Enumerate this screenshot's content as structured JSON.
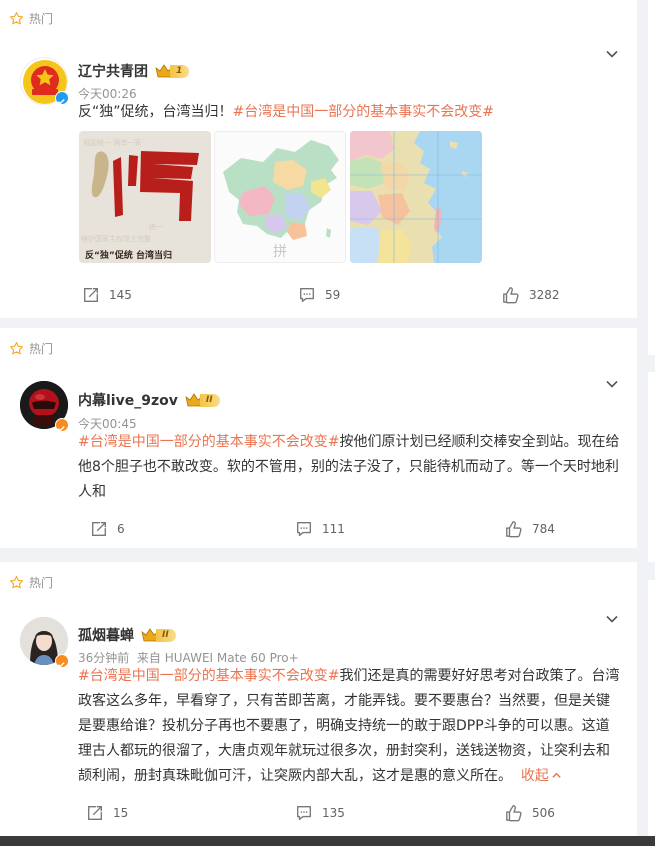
{
  "hot_label": "热门",
  "posts": [
    {
      "author": "辽宁共青团",
      "level": "1",
      "time": "今天00:26",
      "content_plain": "反“独”促统，台湾当归！",
      "content_tag": "#台湾是中国一部分的基本事实不会改变#",
      "image_caption_big": "归",
      "image_caption_small": "反“独”促统 台湾当归",
      "image2_watermark": "拼",
      "reposts": "145",
      "comments": "59",
      "likes": "3282"
    },
    {
      "author": "内幕live_9zov",
      "level": "II",
      "time": "今天00:45",
      "content_tag": "#台湾是中国一部分的基本事实不会改变#",
      "content_line1": "按他们原计划已经顺利交棒安全到站。现在给",
      "content_line2": "他8个胆子也不敢改变。软的不管用，别的法子没了，只能待机而动了。等一个天时地利",
      "content_line3": "人和",
      "reposts": "6",
      "comments": "111",
      "likes": "784"
    },
    {
      "author": "孤烟暮蝉",
      "level": "II",
      "time": "36分钟前",
      "source": "来自 HUAWEI Mate 60 Pro+",
      "content_tag": "#台湾是中国一部分的基本事实不会改变#",
      "content_line1": "我们还是真的需要好好思考对台政策了。台湾",
      "content_line2": "政客这么多年，早看穿了，只有苦即苦离，才能弄钱。要不要惠台？当然要，但是关键",
      "content_line3": "是要惠给谁？投机分子再也不要惠了，明确支持统一的敢于跟DPP斗争的可以惠。这道",
      "content_line4": "理古人都玩的很溜了，大唐贞观年就玩过很多次，册封突利，送钱送物资，让突利去和",
      "content_line5": "颉利闹，册封真珠毗伽可汗，让突厥内部大乱，这才是惠的意义所在。",
      "fold_label": "收起",
      "reposts": "15",
      "comments": "135",
      "likes": "506"
    }
  ],
  "colors": {
    "accent": "#eb7350",
    "gray": "#939393",
    "bg": "#f1f2f5"
  }
}
